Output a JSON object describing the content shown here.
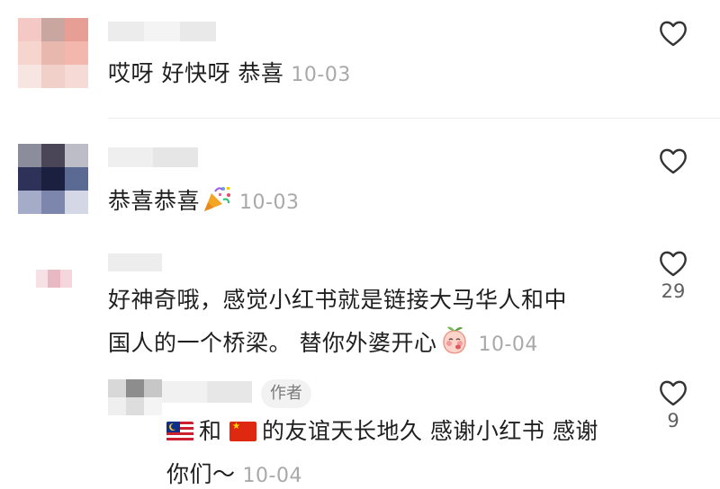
{
  "comments": [
    {
      "text": "哎呀 好快呀 恭喜",
      "date": "10-03",
      "like_count": "",
      "avatar_colors": [
        "#f4c8c4",
        "#c9a7a0",
        "#e79f95",
        "#f6d5ce",
        "#e8b8ae",
        "#f3b7ad",
        "#f7e5e2",
        "#f1d0ca",
        "#f5dad5"
      ]
    },
    {
      "text": "恭喜恭喜",
      "date": "10-03",
      "emoji": "party-popper-icon",
      "like_count": "",
      "avatar_colors": [
        "#8b8c9c",
        "#4a4658",
        "#bdbdc7",
        "#2e3258",
        "#1c2040",
        "#5b6a93",
        "#a5acc8",
        "#7d87ad",
        "#d3d7e6"
      ]
    },
    {
      "text_line1": "好神奇哦，感觉小红书就是链接大马华人和中",
      "text_line2": "国人的一个桥梁。 替你外婆开心",
      "date": "10-04",
      "emoji": "blushing-peach-icon",
      "like_count": "29",
      "avatar_colors": [
        "#f6e2e6",
        "#e9b9c3",
        "#f4d6dc"
      ]
    }
  ],
  "reply": {
    "author_badge": "作者",
    "text_connector": "和",
    "text_rest": "的友谊天长地久 感谢小红书 感谢",
    "text_line2": "你们～",
    "date": "10-04",
    "like_count": "9",
    "flag_1": "malaysia-flag-icon",
    "flag_2": "china-flag-icon",
    "avatar_colors": [
      "#d8d8d8",
      "#8d8d8d",
      "#c7c7c7",
      "#efefef",
      "#dddddd",
      "#f4f4f4"
    ]
  },
  "colors": {
    "text": "#1f1f1f",
    "date": "#a9a9a9",
    "icon": "#333333"
  }
}
